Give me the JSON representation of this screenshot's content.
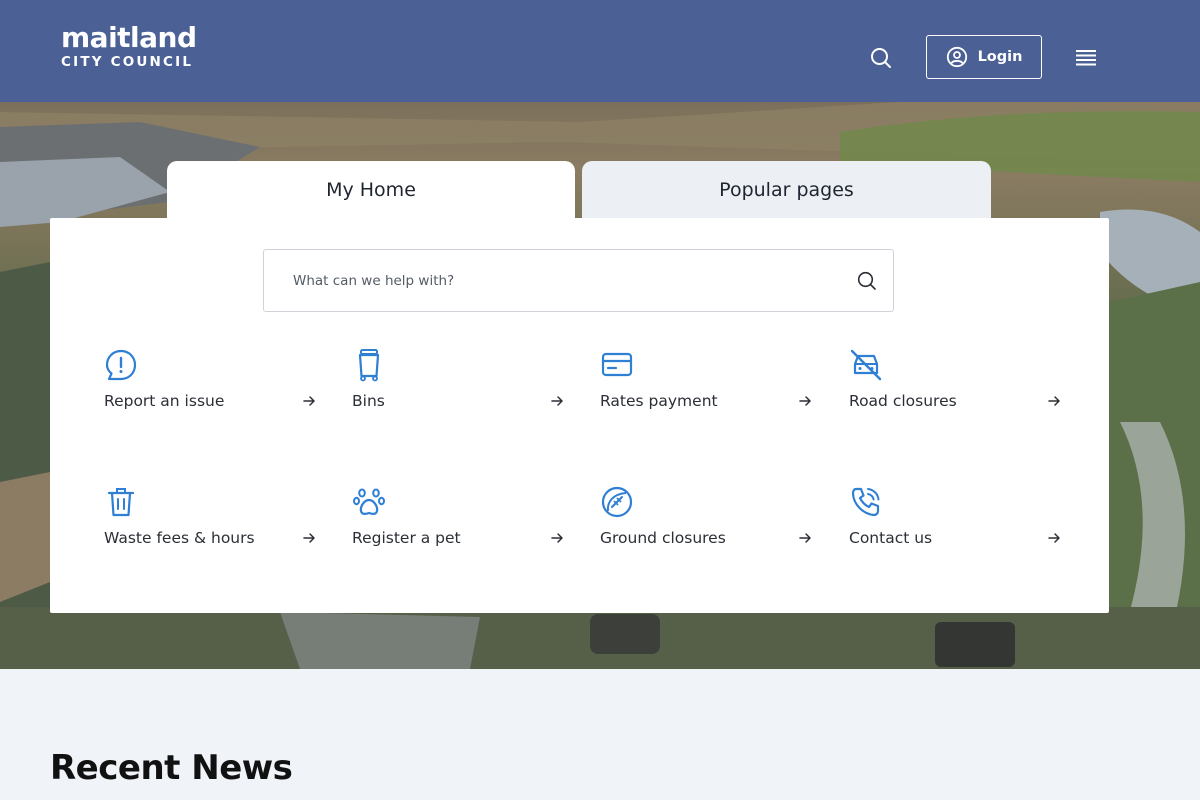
{
  "header": {
    "logo_main": "maitland",
    "logo_sub": "CITY COUNCIL",
    "login_label": "Login",
    "icons": [
      "search-icon",
      "user-circle-icon",
      "menu-icon"
    ]
  },
  "tabs": [
    {
      "label": "My Home",
      "active": true
    },
    {
      "label": "Popular pages",
      "active": false
    }
  ],
  "search": {
    "placeholder": "What can we help with?",
    "value": ""
  },
  "quick_links": [
    {
      "label": "Report an issue",
      "icon": "alert-bubble-icon"
    },
    {
      "label": "Bins",
      "icon": "wheelie-bin-icon"
    },
    {
      "label": "Rates payment",
      "icon": "credit-card-icon"
    },
    {
      "label": "Road closures",
      "icon": "car-off-icon"
    },
    {
      "label": "Waste fees & hours",
      "icon": "trash-icon"
    },
    {
      "label": "Register a pet",
      "icon": "paw-icon"
    },
    {
      "label": "Ground closures",
      "icon": "football-icon"
    },
    {
      "label": "Contact us",
      "icon": "phone-call-icon"
    }
  ],
  "news": {
    "title": "Recent News"
  },
  "colors": {
    "header": "#4b6196",
    "accent": "#2f7fd4",
    "page_bg": "#f0f3f7"
  }
}
